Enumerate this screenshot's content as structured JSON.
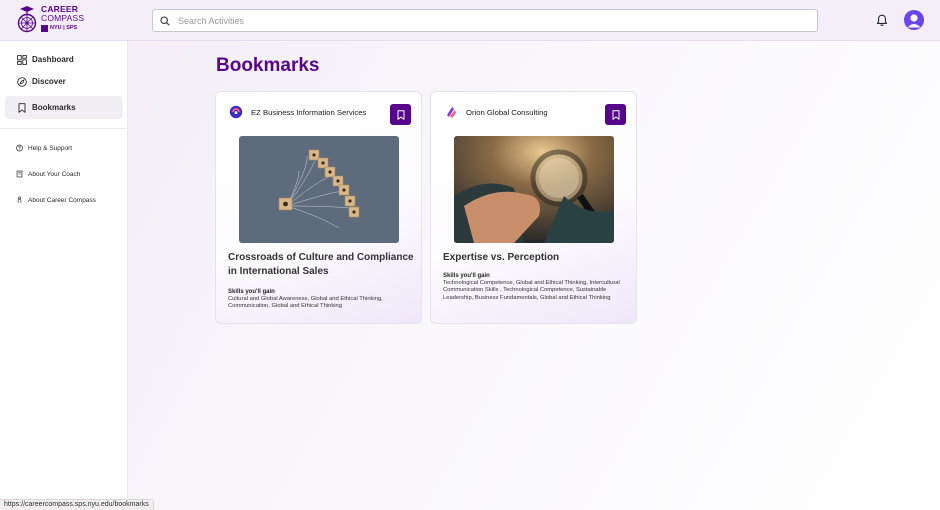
{
  "app": {
    "logo_line1": "CAREER",
    "logo_line2": "COMPASS",
    "logo_sub": "NYU | SPS",
    "brand_color": "#57068c"
  },
  "search": {
    "placeholder": "Search Activities",
    "value": ""
  },
  "header": {
    "icons": [
      "search-icon",
      "bell-icon",
      "avatar"
    ]
  },
  "sidebar": {
    "items": [
      {
        "label": "Dashboard",
        "icon": "grid-icon",
        "active": false
      },
      {
        "label": "Discover",
        "icon": "compass-icon",
        "active": false
      },
      {
        "label": "Bookmarks",
        "icon": "bookmark-icon",
        "active": true
      }
    ],
    "secondary": [
      {
        "label": "Help & Support",
        "icon": "help-icon"
      },
      {
        "label": "About Your Coach",
        "icon": "book-icon"
      },
      {
        "label": "About Career Compass",
        "icon": "person-icon"
      }
    ]
  },
  "main": {
    "title": "Bookmarks",
    "cards": [
      {
        "company": "EZ Business Information Services",
        "title": "Crossroads of Culture and Compliance in International Sales",
        "skills_label": "Skills you'll gain",
        "skills": "Cultural and Global Awareness, Global and Ethical Thinking, Communication, Global and Ethical Thinking",
        "image": "wooden-blocks-network-image"
      },
      {
        "company": "Orion Global Consulting",
        "title": "Expertise vs. Perception",
        "skills_label": "Skills you'll gain",
        "skills": "Technological Competence, Global and Ethical Thinking, Intercultural Communication Skills , Technological Competence, Sustainable Leadership, Business Fundamentals, Global and Ethical Thinking",
        "image": "magnifying-glass-image"
      }
    ]
  },
  "status_bar": {
    "url": "https://careercompass.sps.nyu.edu/bookmarks"
  }
}
